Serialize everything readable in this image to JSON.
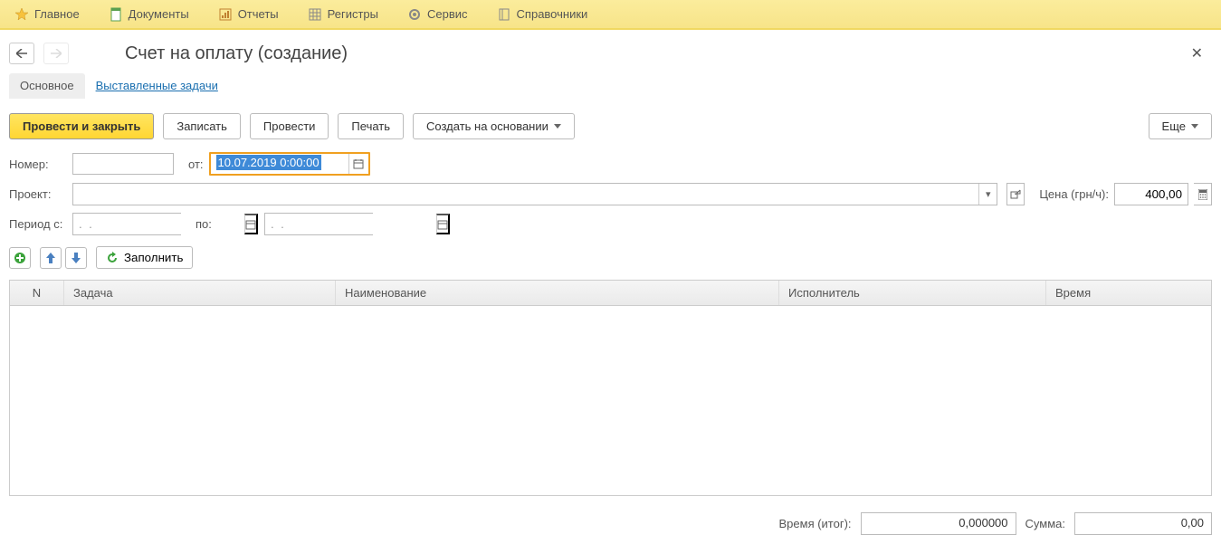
{
  "menubar": {
    "items": [
      {
        "label": "Главное",
        "icon": "star"
      },
      {
        "label": "Документы",
        "icon": "doc"
      },
      {
        "label": "Отчеты",
        "icon": "report"
      },
      {
        "label": "Регистры",
        "icon": "register"
      },
      {
        "label": "Сервис",
        "icon": "gear"
      },
      {
        "label": "Справочники",
        "icon": "book"
      }
    ]
  },
  "page": {
    "title": "Счет на оплату (создание)"
  },
  "tabs": {
    "main": "Основное",
    "tasks": "Выставленные задачи"
  },
  "toolbar": {
    "post_close": "Провести и закрыть",
    "save": "Записать",
    "post": "Провести",
    "print": "Печать",
    "create_based": "Создать на основании",
    "more": "Еще"
  },
  "form": {
    "number_label": "Номер:",
    "number_value": "",
    "from_label": "от:",
    "date_value": "10.07.2019  0:00:00",
    "project_label": "Проект:",
    "project_value": "",
    "price_label": "Цена (грн/ч):",
    "price_value": "400,00",
    "period_from_label": "Период с:",
    "period_from_value": ".  .",
    "period_to_label": "по:",
    "period_to_value": ".  ."
  },
  "minibar": {
    "fill": "Заполнить"
  },
  "grid": {
    "columns": {
      "n": "N",
      "task": "Задача",
      "name": "Наименование",
      "exec": "Исполнитель",
      "time": "Время"
    }
  },
  "totals": {
    "time_label": "Время (итог):",
    "time_value": "0,000000",
    "sum_label": "Сумма:",
    "sum_value": "0,00"
  }
}
